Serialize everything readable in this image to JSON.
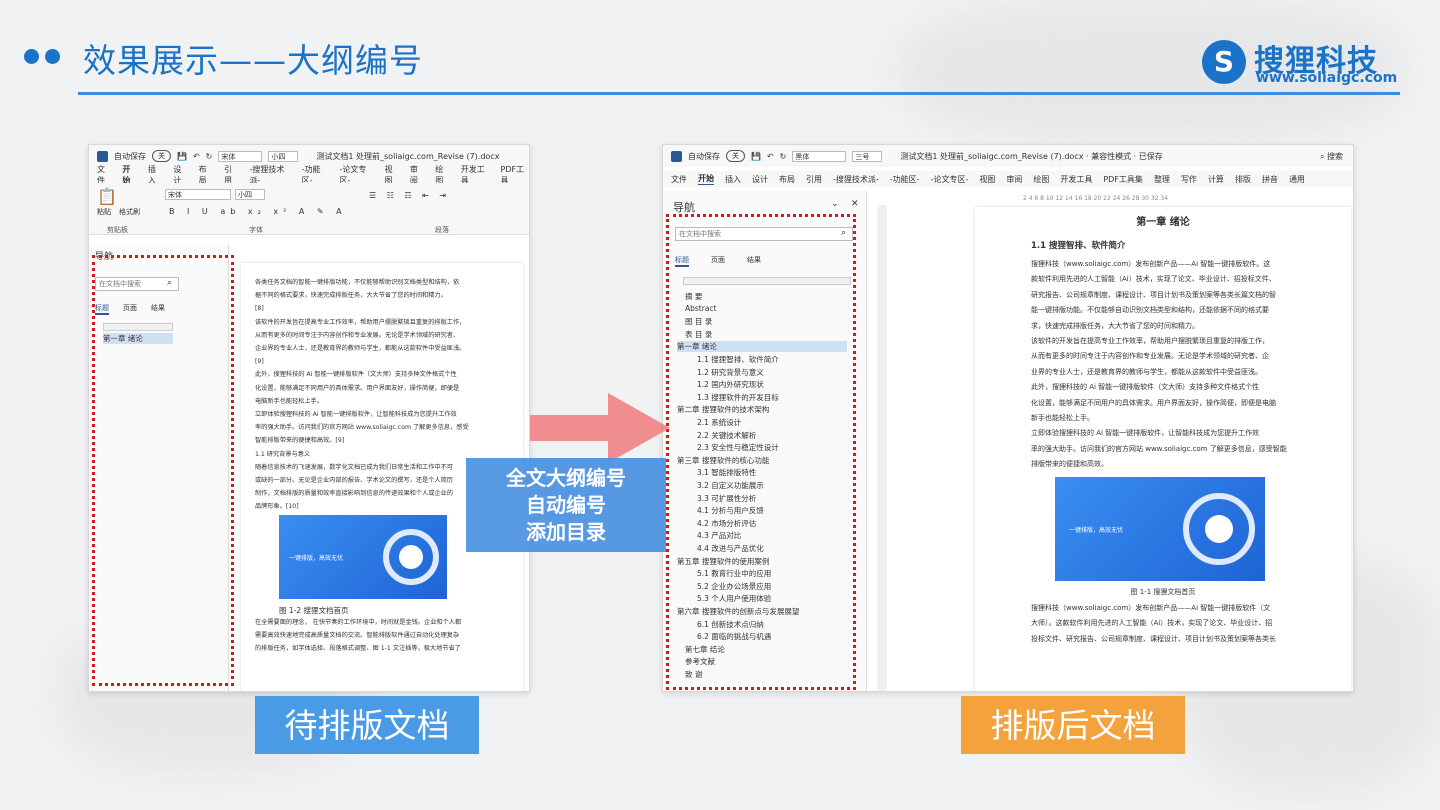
{
  "header": {
    "title": "效果展示——大纲编号"
  },
  "logo": {
    "name": "搜狸科技",
    "url": "www.soliaigc.com"
  },
  "callout": {
    "lines": [
      "全文大纲编号",
      "自动编号",
      "添加目录"
    ]
  },
  "labels": {
    "before": "待排版文档",
    "after": "排版后文档"
  },
  "colors": {
    "brand": "#1a73c8",
    "callout": "#4a90e2",
    "before_label": "#4a9be5",
    "after_label": "#f3a23c",
    "highlight": "#c81e1e"
  },
  "before": {
    "autosave": "自动保存",
    "toggle": "关",
    "font": "宋体",
    "size": "小四",
    "doc_title": "测试文档1 处理前_soliaigc.com_Revise (7).docx",
    "menu": [
      "文件",
      "开始",
      "插入",
      "设计",
      "布局",
      "引用",
      "-搜狸技术派-",
      "-功能区-",
      "-论文专区-",
      "视图",
      "审阅",
      "绘图",
      "开发工具",
      "PDF工具"
    ],
    "ribbon_font": "宋体",
    "ribbon_size": "小四",
    "groups": [
      "剪贴板",
      "字体",
      "段落"
    ],
    "paste": "粘贴",
    "format_painter": "格式刷",
    "nav_title": "导航",
    "nav_search": "在文档中搜索",
    "nav_tabs": [
      "标题",
      "页面",
      "结果"
    ],
    "nav_item": "第一章 绪论",
    "doc_lines": [
      "各类任务文档的智能一键排版功能，不仅能够帮助识别文档类型和结构，依",
      "据不同的格式要求，快速完成排版任务，大大节省了您的时间和精力。",
      "[8]",
      "该软件的开发旨在提高专业工作效率，帮助用户摆脱繁琐且重复的排版工作，",
      "从而有更多的时间专注于内容创作和专业发展。无论是学术领域的研究者、",
      "企业界的专业人士，还是教育界的教师与学生，都能从这款软件中受益匪浅。",
      "[9]",
      "此外，搜狸科技的 Ai 智能一键排版软件（文大师）支持多种文件格式个性",
      "化设置，能够满足不同用户的具体需求。用户界面友好，操作简便，即便是",
      "电脑新手也能轻松上手。",
      "立即体验搜狸科技的 Ai 智能一键排版软件，让智能科技成为您提升工作效",
      "率的强大助手。访问我们的官方网站 www.soliaigc.com 了解更多信息，感受",
      "智能排版带来的便捷和高效。[9]",
      "1.1  研究背景与意义",
      "随着信息技术的飞速发展，数字化文档已成为我们日常生活和工作中不可",
      "或缺的一部分。无论是企业内部的报告、学术论文的撰写，还是个人简历",
      "制作，文档排版的质量和效率直接影响到信息的传递效果和个人或企业的",
      "品牌形象。[10]"
    ],
    "img_text": "一键排版，高效无忧",
    "fig_caption": "图 1-2  搜狸文档首页",
    "doc_lines2": [
      "在全需要面的理念，  在快节奏的工作环境中，时间就是金钱。企业和个人都",
      "需要高效快速地完成高质量文档的交流。智能排版软件通过自动化处理复杂",
      "的排版任务，如字体选择、段落格式调整、图 1-1 文注插等，极大地节省了"
    ]
  },
  "after": {
    "autosave": "自动保存",
    "toggle": "关",
    "font": "黑体",
    "size": "三号",
    "doc_title": "测试文档1 处理前_soliaigc.com_Revise (7).docx  ·  兼容性模式 · 已保存",
    "search": "搜索",
    "menu": [
      "文件",
      "开始",
      "插入",
      "设计",
      "布局",
      "引用",
      "-搜狸技术派-",
      "-功能区-",
      "-论文专区-",
      "视图",
      "审阅",
      "绘图",
      "开发工具",
      "PDF工具集",
      "整理",
      "写作",
      "计算",
      "排版",
      "拼音",
      "通用"
    ],
    "nav_title": "导航",
    "nav_search": "在文档中搜索",
    "nav_tabs": [
      "标题",
      "页面",
      "结果"
    ],
    "outline": [
      {
        "t": "摘  要",
        "l": 1
      },
      {
        "t": "Abstract",
        "l": 1
      },
      {
        "t": "图  目  录",
        "l": 1
      },
      {
        "t": "表  目  录",
        "l": 1
      },
      {
        "t": "第一章  绪论",
        "l": 0,
        "hl": true
      },
      {
        "t": "1.1 搜狸智排、软件简介",
        "l": 2
      },
      {
        "t": "1.2 研究背景与意义",
        "l": 2
      },
      {
        "t": "1.2 国内外研究现状",
        "l": 2
      },
      {
        "t": "1.3 搜狸软件的开发目标",
        "l": 2
      },
      {
        "t": "第二章  搜狸软件的技术架构",
        "l": 0
      },
      {
        "t": "2.1 系统设计",
        "l": 2
      },
      {
        "t": "2.2 关键技术解析",
        "l": 2
      },
      {
        "t": "2.3 安全性与稳定性设计",
        "l": 2
      },
      {
        "t": "第三章  搜狸软件的核心功能",
        "l": 0
      },
      {
        "t": "3.1 智能排版特性",
        "l": 2
      },
      {
        "t": "3.2 自定义功能展示",
        "l": 2
      },
      {
        "t": "3.3 可扩展性分析",
        "l": 2
      },
      {
        "t": "4.1 分析与用户反馈",
        "l": 2
      },
      {
        "t": "4.2 市场分析评估",
        "l": 2
      },
      {
        "t": "4.3 产品对比",
        "l": 2
      },
      {
        "t": "4.4 改进与产品优化",
        "l": 2
      },
      {
        "t": "第五章  搜狸软件的使用案例",
        "l": 0
      },
      {
        "t": "5.1 教育行业中的应用",
        "l": 2
      },
      {
        "t": "5.2 企业办公场景应用",
        "l": 2
      },
      {
        "t": "5.3 个人用户使用体验",
        "l": 2
      },
      {
        "t": "第六章  搜狸软件的创新点与发展展望",
        "l": 0
      },
      {
        "t": "6.1 创新技术点归纳",
        "l": 2
      },
      {
        "t": "6.2 面临的挑战与机遇",
        "l": 2
      },
      {
        "t": "第七章  结论",
        "l": 1
      },
      {
        "t": "参考文献",
        "l": 1
      },
      {
        "t": "致  谢",
        "l": 1
      }
    ],
    "ruler": "2   4   6   8   10   12   14   16   18   20   22   24   26   28   30   32   34",
    "chapter": "第一章  绪论",
    "section": "1.1  搜狸智排、软件简介",
    "paras": [
      "搜狸科技（www.soliaigc.com）发布创新产品——Ai 智能一键排版软件。这",
      "款软件利用先进的人工智能（Ai）技术，实现了论文、毕业设计、招投标文件、",
      "研究报告、公司规章制度、课程设计、项目计划书及策划案等各类长篇文档的智",
      "能一键排版功能。不仅能够自动识别文档类型和结构，还能依据不同的格式要",
      "求，快速完成排版任务，大大节省了您的时间和精力。",
      "该软件的开发旨在提高专业工作效率，帮助用户摆脱繁琐且重复的排版工作，",
      "从而有更多的时间专注于内容创作和专业发展。无论是学术领域的研究者、企",
      "业界的专业人士，还是教育界的教师与学生，都能从这款软件中受益匪浅。",
      "此外，搜狸科技的 Ai 智能一键排版软件（文大师）支持多种文件格式个性",
      "化设置，能够满足不同用户的具体需求。用户界面友好，操作简便，即便是电脑",
      "新手也能轻松上手。",
      "立即体验搜狸科技的 Ai 智能一键排版软件，让智能科技成为您提升工作效",
      "率的强大助手。访问我们的官方网站 www.soliaigc.com 了解更多信息，感受智能",
      "排版带来的便捷和高效。"
    ],
    "img_text": "一键排版，高效无忧",
    "fig_caption": "图 1-1  搜狸文档首页",
    "paras2": [
      "搜狸科技（www.soliaigc.com）发布创新产品——Ai 智能一键排版软件（文",
      "大师）。这款软件利用先进的人工智能（Ai）技术，实现了论文、毕业设计、招",
      "投标文件、研究报告、公司规章制度、课程设计、项目计划书及策划案等各类长"
    ]
  }
}
